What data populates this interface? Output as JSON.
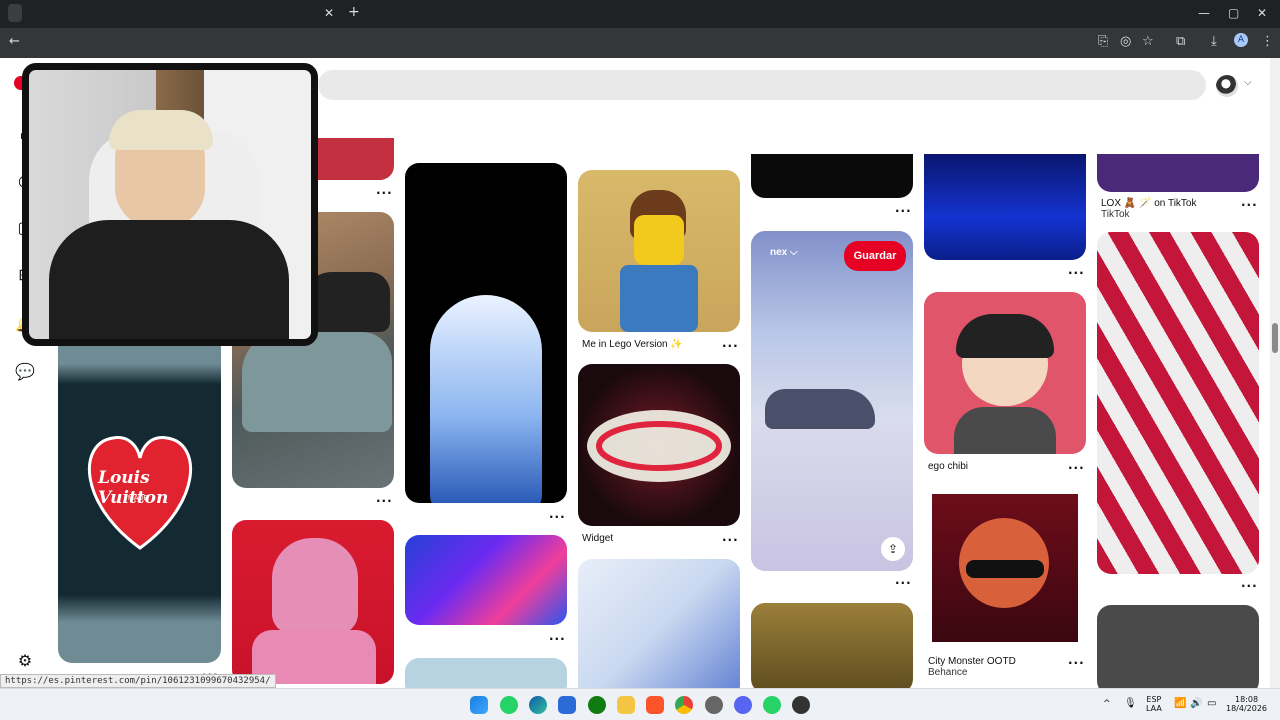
{
  "browser": {
    "close_tab_glyph": "✕",
    "new_tab_glyph": "+",
    "back_glyph": "←",
    "window_controls": [
      "—",
      "▢",
      "✕"
    ],
    "toolbar_icons": [
      "install-app-icon",
      "eye-off-icon",
      "star-icon",
      "extensions-icon",
      "download-icon",
      "profile-icon",
      "menu-icon"
    ],
    "profile_letter": "A",
    "status_url": "https://es.pinterest.com/pin/1061231099670432954/"
  },
  "pinterest": {
    "sidebar_icons": [
      "home-icon",
      "explore-icon",
      "boards-icon",
      "create-icon",
      "notifications-icon",
      "messages-icon",
      "settings-icon"
    ],
    "pins": [
      {
        "id": "lego",
        "caption": "Me in Lego Version ✨"
      },
      {
        "id": "sound",
        "caption": "Widget"
      },
      {
        "id": "car-sky",
        "board_label": "nex ⌵",
        "save_label": "Guardar"
      },
      {
        "id": "chibi",
        "caption": "ego chibi"
      },
      {
        "id": "tiktok",
        "caption": "LOX 🧸 🪄 on TikTok",
        "subcaption": "TikTok"
      },
      {
        "id": "monster",
        "caption": "City Monster OOTD",
        "subcaption": "Behance"
      },
      {
        "id": "louis",
        "logo_text": "Louis Vuitton",
        "logo_sub": "MADE"
      }
    ],
    "more_label": "···"
  },
  "taskbar": {
    "language": "ESP",
    "layout": "LAA",
    "time": "18:08",
    "date": "18/4/2026"
  },
  "colors": {
    "pinterest_red": "#e60023",
    "chrome_dark": "#202124"
  }
}
